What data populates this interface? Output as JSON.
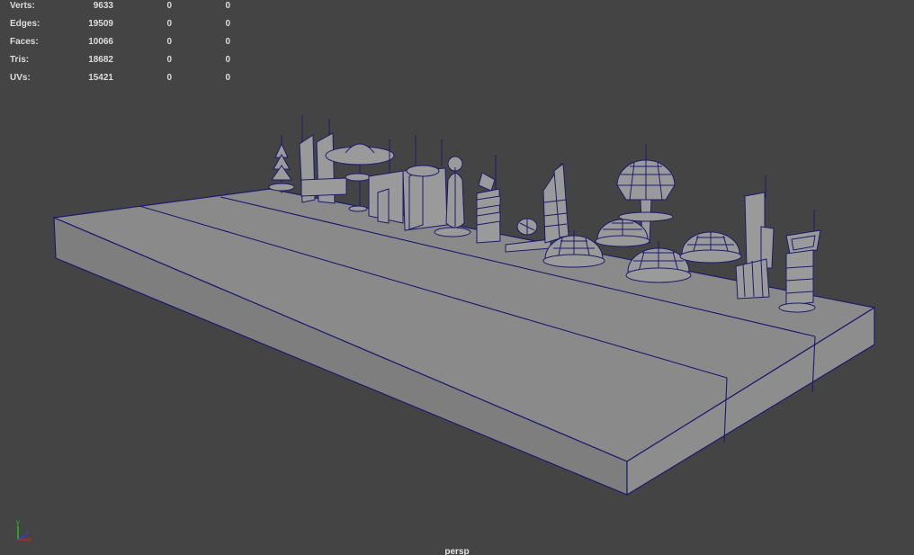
{
  "hud": {
    "rows": [
      {
        "label": "Verts:",
        "total": "9633",
        "selected": "0",
        "component": "0"
      },
      {
        "label": "Edges:",
        "total": "19509",
        "selected": "0",
        "component": "0"
      },
      {
        "label": "Faces:",
        "total": "10066",
        "selected": "0",
        "component": "0"
      },
      {
        "label": "Tris:",
        "total": "18682",
        "selected": "0",
        "component": "0"
      },
      {
        "label": "UVs:",
        "total": "15421",
        "selected": "0",
        "component": "0"
      }
    ]
  },
  "viewport": {
    "camera_label": "persp",
    "background_color": "#444444",
    "wire_color": "#1a1a6e",
    "surface_color": "#8a8a8a"
  },
  "axis_indicator": {
    "x_label": "x",
    "y_label": "y",
    "z_label": "z",
    "x_color": "#d02020",
    "y_color": "#20c020",
    "z_color": "#3040e0"
  },
  "icons": {
    "axis": "view-axis-icon"
  }
}
